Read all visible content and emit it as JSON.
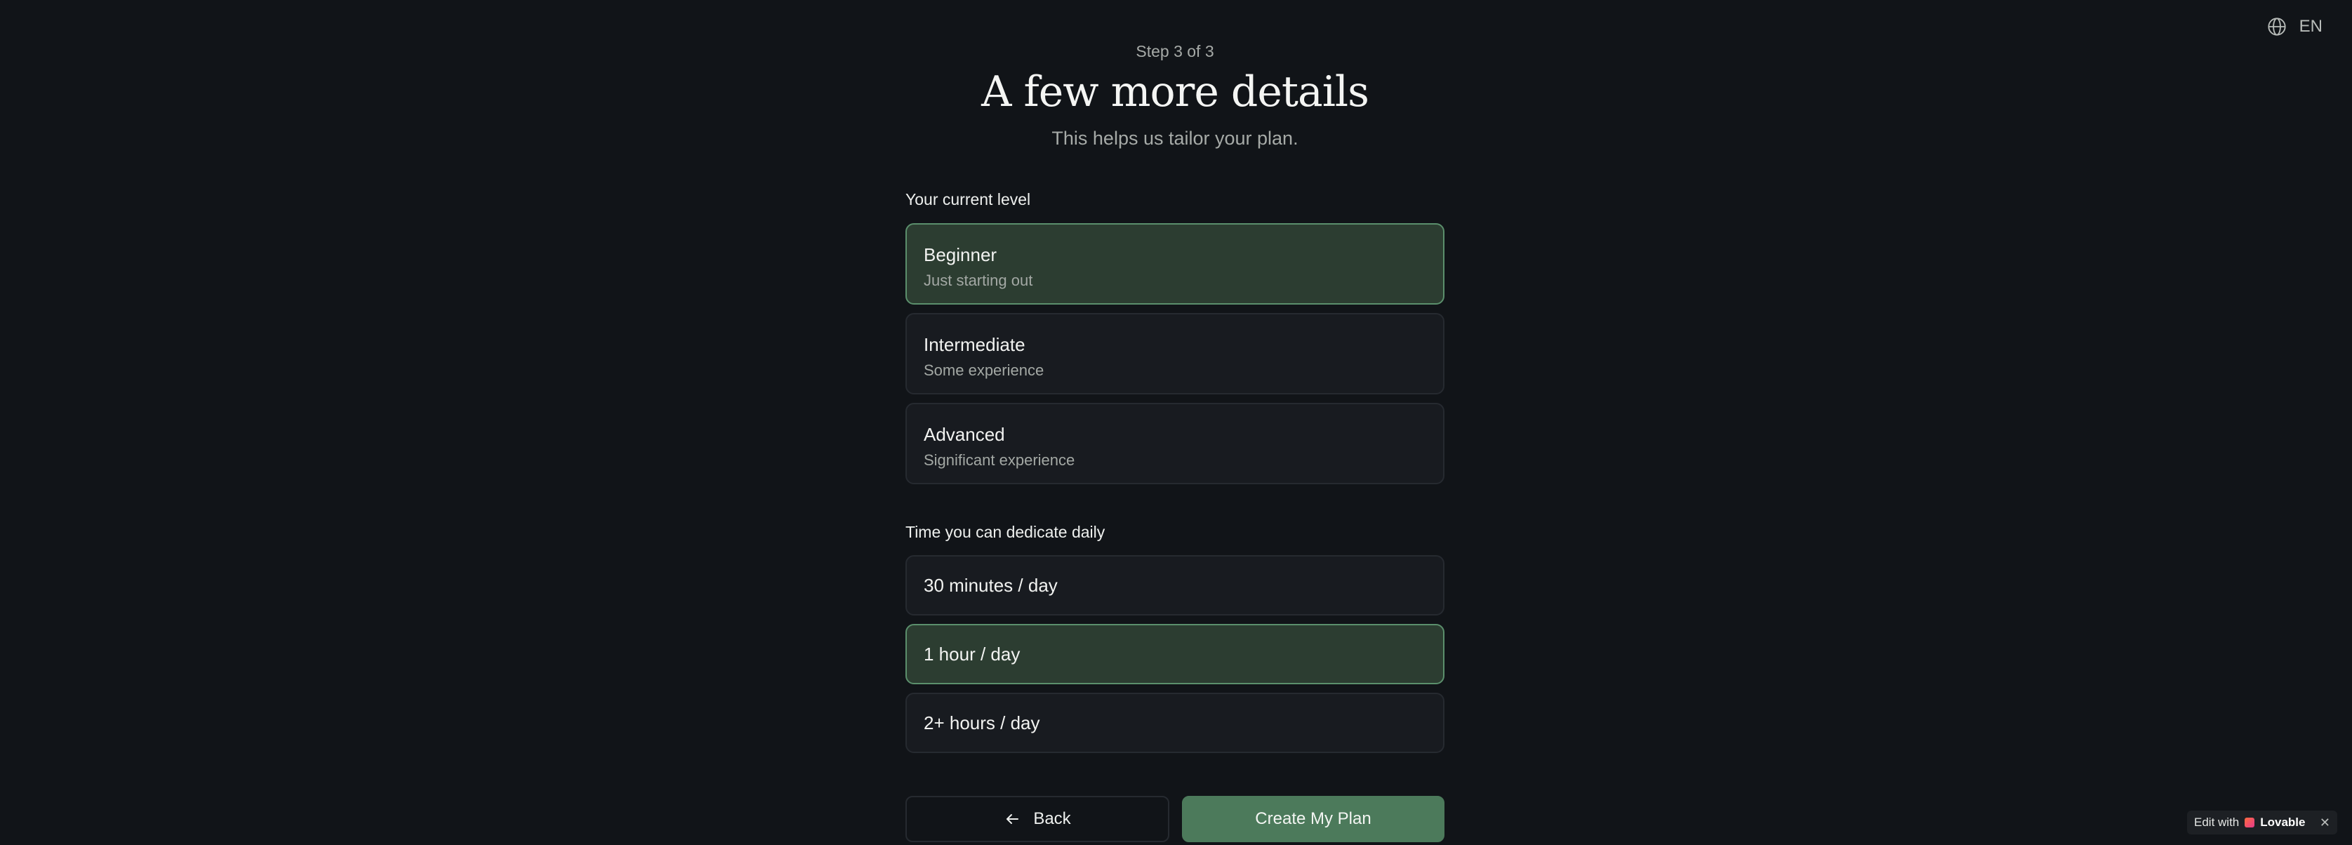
{
  "language": {
    "code": "EN",
    "icon": "globe-icon"
  },
  "header": {
    "step": "Step 3 of 3",
    "title": "A few more details",
    "subtitle": "This helps us tailor your plan."
  },
  "level_section": {
    "label": "Your current level",
    "selected": "Beginner",
    "options": [
      {
        "title": "Beginner",
        "description": "Just starting out"
      },
      {
        "title": "Intermediate",
        "description": "Some experience"
      },
      {
        "title": "Advanced",
        "description": "Significant experience"
      }
    ]
  },
  "time_section": {
    "label": "Time you can dedicate daily",
    "selected": "1 hour / day",
    "options": [
      {
        "title": "30 minutes / day"
      },
      {
        "title": "1 hour / day"
      },
      {
        "title": "2+ hours / day"
      }
    ]
  },
  "actions": {
    "back_label": "Back",
    "back_icon": "arrow-left-icon",
    "create_label": "Create My Plan"
  },
  "badge": {
    "prefix": "Edit with",
    "brand": "Lovable",
    "close": "✕"
  },
  "colors": {
    "background": "#111418",
    "selected_fill": "#2c3d31",
    "selected_border": "#5b8f6c",
    "primary_button": "#4c7a5b"
  }
}
